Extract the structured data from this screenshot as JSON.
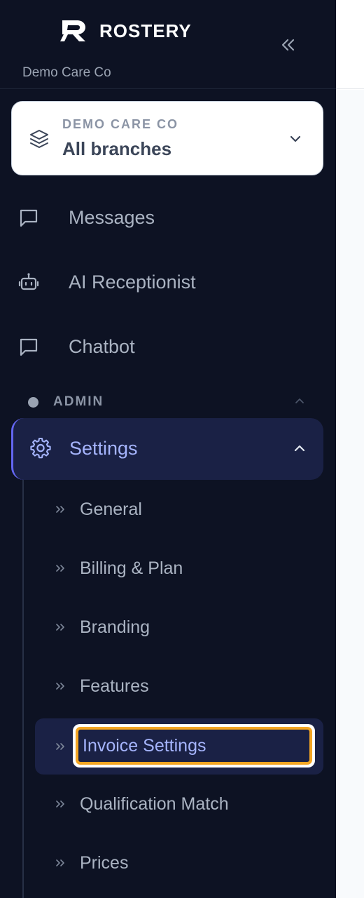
{
  "brand": {
    "name": "ROSTERY",
    "org_caption": "Demo Care Co"
  },
  "branch_selector": {
    "org": "DEMO CARE CO",
    "branch": "All branches"
  },
  "nav": [
    {
      "label": "Messages",
      "icon": "message-square-icon"
    },
    {
      "label": "AI Receptionist",
      "icon": "bot-icon"
    },
    {
      "label": "Chatbot",
      "icon": "message-square-icon"
    }
  ],
  "admin_section": {
    "label": "ADMIN"
  },
  "settings": {
    "label": "Settings",
    "icon": "gear-icon",
    "items": [
      {
        "label": "General"
      },
      {
        "label": "Billing & Plan"
      },
      {
        "label": "Branding"
      },
      {
        "label": "Features"
      },
      {
        "label": "Invoice Settings",
        "active": true
      },
      {
        "label": "Qualification Match"
      },
      {
        "label": "Prices"
      }
    ]
  },
  "colors": {
    "sidebar_bg": "#0d1223",
    "active_bg": "#1a2145",
    "active_text": "#a5b4fc",
    "accent": "#6366f1",
    "focus_ring": "#f5a623"
  }
}
